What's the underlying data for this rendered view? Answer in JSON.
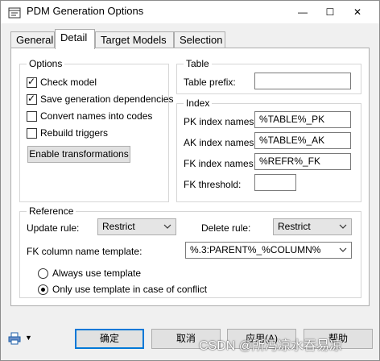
{
  "window": {
    "title": "PDM Generation Options",
    "minimize_glyph": "—",
    "maximize_glyph": "☐",
    "close_glyph": "✕"
  },
  "tabs": [
    {
      "label": "General",
      "active": false
    },
    {
      "label": "Detail",
      "active": true
    },
    {
      "label": "Target Models",
      "active": false
    },
    {
      "label": "Selection",
      "active": false
    }
  ],
  "options": {
    "legend": "Options",
    "items": [
      {
        "label": "Check model",
        "checked": true
      },
      {
        "label": "Save generation dependencies",
        "checked": true
      },
      {
        "label": "Convert names into codes",
        "checked": false
      },
      {
        "label": "Rebuild triggers",
        "checked": false
      }
    ],
    "enable_transformations_label": "Enable transformations",
    "check_glyph": "✓"
  },
  "table": {
    "legend": "Table",
    "prefix_label": "Table prefix:",
    "prefix_value": ""
  },
  "index": {
    "legend": "Index",
    "pk_label": "PK index names:",
    "pk_value": "%TABLE%_PK",
    "ak_label": "AK index names:",
    "ak_value": "%TABLE%_AK",
    "fk_label": "FK index names:",
    "fk_value": "%REFR%_FK",
    "threshold_label": "FK threshold:",
    "threshold_value": ""
  },
  "reference": {
    "legend": "Reference",
    "update_rule_label": "Update rule:",
    "update_rule_value": "Restrict",
    "delete_rule_label": "Delete rule:",
    "delete_rule_value": "Restrict",
    "fk_template_label": "FK column name template:",
    "fk_template_value": "%.3:PARENT%_%COLUMN%",
    "radio_always": "Always use template",
    "radio_conflict": "Only use template in case of conflict",
    "selected_radio": "conflict"
  },
  "footer": {
    "ok_label": "确定",
    "cancel_label": "取消",
    "apply_label": "应用(A)",
    "help_label": "帮助",
    "dropdown_glyph": "▼",
    "watermark": "CSDN @所冯凉水吞易凉"
  },
  "colors": {
    "accent": "#0078d7",
    "panel_bg": "#ffffff",
    "dialog_bg": "#f0f0f0"
  }
}
